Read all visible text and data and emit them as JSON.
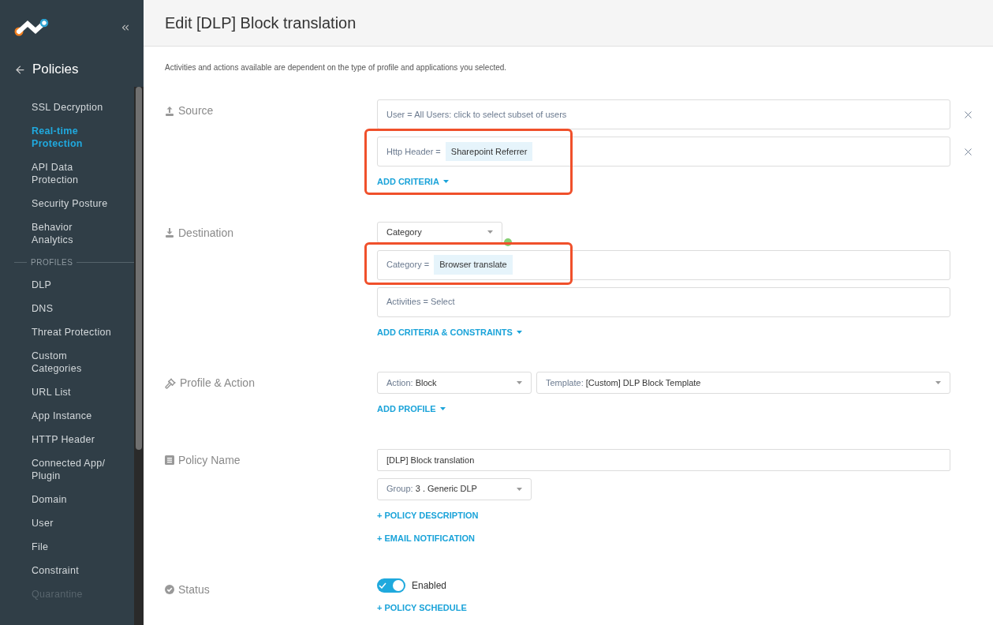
{
  "sidebar": {
    "back_title": "Policies",
    "items": [
      {
        "kind": "item",
        "label": "SSL Decryption",
        "selected": false
      },
      {
        "kind": "item",
        "label": "Real-time Protection",
        "selected": true
      },
      {
        "kind": "item",
        "label": "API Data Protection",
        "selected": false
      },
      {
        "kind": "item",
        "label": "Security Posture",
        "selected": false
      },
      {
        "kind": "item",
        "label": "Behavior Analytics",
        "selected": false
      },
      {
        "kind": "heading",
        "label": "PROFILES"
      },
      {
        "kind": "item",
        "label": "DLP",
        "selected": false
      },
      {
        "kind": "item",
        "label": "DNS",
        "selected": false
      },
      {
        "kind": "item",
        "label": "Threat Protection",
        "selected": false
      },
      {
        "kind": "item",
        "label": "Custom Categories",
        "selected": false
      },
      {
        "kind": "item",
        "label": "URL List",
        "selected": false
      },
      {
        "kind": "item",
        "label": "App Instance",
        "selected": false
      },
      {
        "kind": "item",
        "label": "HTTP Header",
        "selected": false
      },
      {
        "kind": "item",
        "label": "Connected App/ Plugin",
        "selected": false
      },
      {
        "kind": "item",
        "label": "Domain",
        "selected": false
      },
      {
        "kind": "item",
        "label": "User",
        "selected": false
      },
      {
        "kind": "item",
        "label": "File",
        "selected": false
      },
      {
        "kind": "item",
        "label": "Constraint",
        "selected": false
      },
      {
        "kind": "faded",
        "label": "Quarantine",
        "selected": false
      }
    ]
  },
  "page_title": "Edit [DLP] Block translation",
  "description": "Activities and actions available are dependent on the type of profile and applications you selected.",
  "sections": [
    {
      "label": "Source",
      "items": [
        {
          "kind": "criteria",
          "key": "User =",
          "text": "All Users: click to select subset of users",
          "removable": true
        },
        {
          "kind": "highlight",
          "items": [
            {
              "kind": "criteria",
              "key": "Http Header =",
              "chip": "Sharepoint Referrer",
              "removable": true
            },
            {
              "kind": "link",
              "text": "ADD CRITERIA",
              "caret": true
            }
          ]
        }
      ]
    },
    {
      "label": "Destination",
      "items": [
        {
          "kind": "select",
          "value": "Category",
          "color": "#86cf73"
        },
        {
          "kind": "highlight",
          "items": [
            {
              "kind": "criteria",
              "key": "Category =",
              "chip": "Browser translate",
              "removable": false
            }
          ]
        },
        {
          "kind": "criteria",
          "key": "Activities =",
          "text": "Select",
          "removable": false
        },
        {
          "kind": "link",
          "text": "ADD CRITERIA & CONSTRAINTS",
          "caret": true
        }
      ]
    },
    {
      "label": "Profile & Action",
      "items": [
        {
          "kind": "selects",
          "selects": [
            {
              "key": "Action:",
              "value": "Block",
              "wide": false
            },
            {
              "key": "Template:",
              "value": "[Custom] DLP Block Template",
              "wide": true
            }
          ]
        },
        {
          "kind": "link",
          "text": "ADD PROFILE",
          "caret": true
        }
      ]
    },
    {
      "label": "Policy Name",
      "items": [
        {
          "kind": "input",
          "value": "[DLP] Block translation"
        },
        {
          "kind": "selects",
          "selects": [
            {
              "key": "Group:",
              "value": "3 . Generic DLP",
              "wide": false
            }
          ]
        },
        {
          "kind": "link",
          "text": "+ POLICY DESCRIPTION",
          "caret": false
        },
        {
          "kind": "link",
          "text": "+ EMAIL NOTIFICATION",
          "caret": false
        }
      ]
    },
    {
      "label": "Status",
      "items": [
        {
          "kind": "toggle",
          "on": true,
          "text": "Enabled"
        },
        {
          "kind": "link",
          "text": "+ POLICY SCHEDULE",
          "caret": false
        }
      ]
    }
  ]
}
